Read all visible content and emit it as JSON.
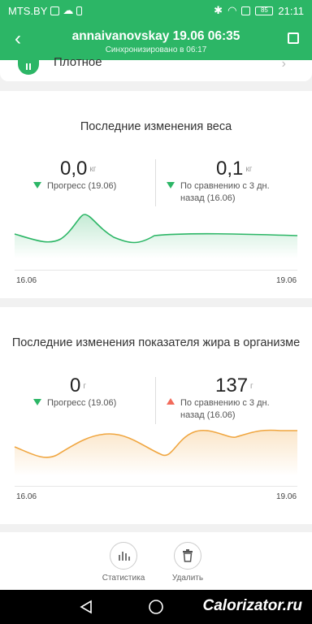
{
  "status_bar": {
    "carrier": "MTS.BY",
    "battery": "85",
    "time": "21:11"
  },
  "header": {
    "title": "annaivanovskay 19.06 06:35",
    "subtitle": "Синхронизировано в 06:17"
  },
  "partial_item": {
    "label": "Плотное"
  },
  "weight_card": {
    "title": "Последние изменения веса",
    "left": {
      "value": "0,0",
      "unit": "кг",
      "caption": "Прогресс (19.06)",
      "trend": "down"
    },
    "right": {
      "value": "0,1",
      "unit": "кг",
      "caption_line1": "По сравнению с 3 дн.",
      "caption_line2": "назад (16.06)",
      "trend": "down"
    },
    "line_color": "#2cb666"
  },
  "fat_card": {
    "title": "Последние изменения показателя жира в организме",
    "left": {
      "value": "0",
      "unit": "г",
      "caption": "Прогресс (19.06)",
      "trend": "down"
    },
    "right": {
      "value": "137",
      "unit": "г",
      "caption_line1": "По сравнению с 3 дн.",
      "caption_line2": "назад (16.06)",
      "trend": "up"
    },
    "line_color": "#f0a640"
  },
  "chart_data": [
    {
      "type": "line",
      "title": "Последние изменения веса",
      "x_ticks": [
        "16.06",
        "19.06"
      ],
      "series": [
        {
          "values": [
            0.0,
            0.0,
            0.6,
            0.0,
            0.0,
            0.05,
            0.05,
            0.0
          ]
        }
      ]
    },
    {
      "type": "line",
      "title": "Последние изменения показателя жира в организме",
      "x_ticks": [
        "16.06",
        "19.06"
      ],
      "series": [
        {
          "values": [
            0.1,
            0.0,
            0.5,
            0.2,
            -0.4,
            0.55,
            0.35,
            0.5,
            0.5
          ]
        }
      ]
    }
  ],
  "actions": {
    "stats": "Статистика",
    "delete": "Удалить"
  },
  "colors": {
    "accent": "#2cb666",
    "up": "#f26b5b",
    "down": "#2cb666"
  },
  "watermark": "Calorizator.ru"
}
